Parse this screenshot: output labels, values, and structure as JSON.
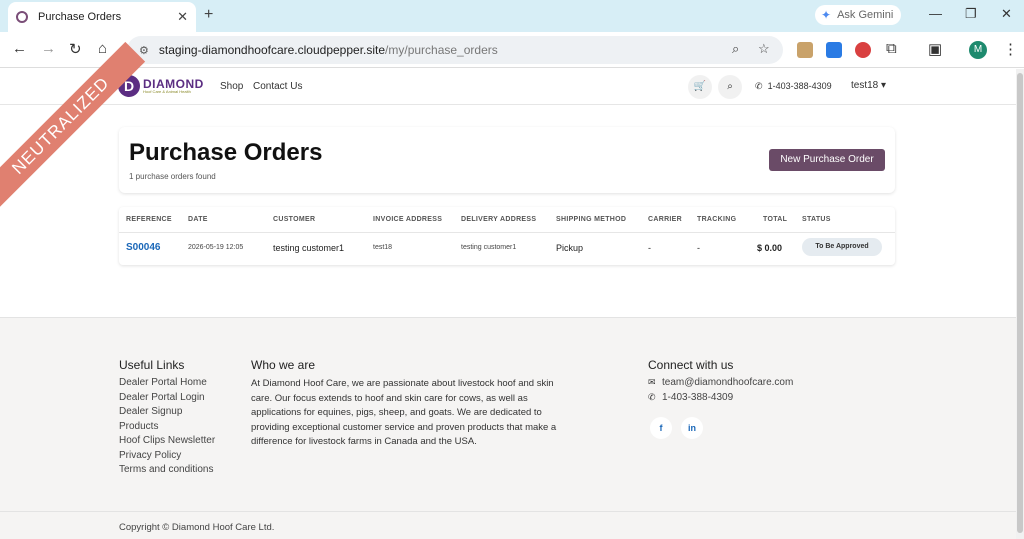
{
  "browser": {
    "tab_title": "Purchase Orders",
    "url_host": "staging-diamondhoofcare.cloudpepper.site",
    "url_path": "/my/purchase_orders",
    "gemini_label": "Ask Gemini",
    "profile_initial": "M"
  },
  "ribbon": "NEUTRALIZED",
  "header": {
    "logo_word": "DIAMOND",
    "logo_sub": "Hoof Care & Animal Health",
    "nav": [
      "Shop",
      "Contact Us"
    ],
    "phone": "1-403-388-4309",
    "user": "test18"
  },
  "page": {
    "title": "Purchase Orders",
    "count_text": "1 purchase orders found",
    "new_button": "New Purchase Order"
  },
  "table": {
    "headers": [
      "REFERENCE",
      "DATE",
      "CUSTOMER",
      "INVOICE ADDRESS",
      "DELIVERY ADDRESS",
      "SHIPPING METHOD",
      "CARRIER",
      "TRACKING",
      "TOTAL",
      "STATUS"
    ],
    "rows": [
      {
        "reference": "S00046",
        "date": "2026-05-19 12:05",
        "customer": "testing customer1",
        "invoice_address": "test18",
        "delivery_address": "testing customer1",
        "shipping_method": "Pickup",
        "carrier": "-",
        "tracking": "-",
        "total": "$ 0.00",
        "status": "To Be Approved"
      }
    ]
  },
  "footer": {
    "useful_links_title": "Useful Links",
    "links": [
      "Dealer Portal Home",
      "Dealer Portal Login",
      "Dealer Signup",
      "Products",
      "Hoof Clips Newsletter",
      "Privacy Policy",
      "Terms and conditions"
    ],
    "about_title": "Who we are",
    "about_text": "At Diamond Hoof Care, we are passionate about livestock hoof and skin care. Our focus extends to hoof and skin care for cows, as well as applications for equines, pigs, sheep, and goats. We are dedicated to providing exceptional customer service and proven products that make a difference for livestock farms in Canada and the USA.",
    "connect_title": "Connect with us",
    "email": "team@diamondhoofcare.com",
    "phone": "1-403-388-4309",
    "social": [
      "f",
      "in"
    ],
    "copyright": "Copyright © Diamond Hoof Care Ltd."
  },
  "colors": {
    "primary_button": "#6a4b67",
    "brand_purple": "#5b2d82",
    "link_blue": "#1a67b8",
    "ribbon": "#e08070"
  }
}
